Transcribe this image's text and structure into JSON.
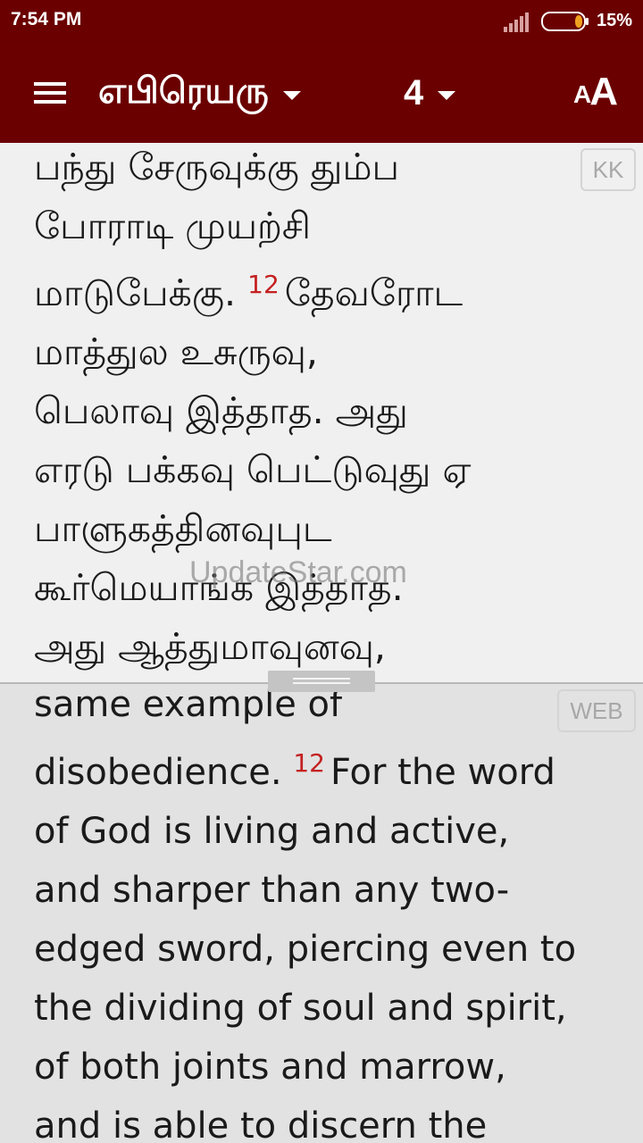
{
  "status_bar": {
    "time": "7:54 PM",
    "battery_percent": "15%",
    "battery_level": 0.15,
    "icons": [
      "signal-icon",
      "battery-icon"
    ]
  },
  "app_bar": {
    "book": "எபிரெயரு",
    "chapter": "4",
    "font_button_small": "A",
    "font_button_large": "A",
    "icons": [
      "menu-icon",
      "caret-down-icon",
      "font-size-icon"
    ],
    "background_color": "#6b0000"
  },
  "top_pane": {
    "version": "KK",
    "lines": [
      "பந்து சேருவுக்கு தும்ப",
      "போராடி முயற்சி",
      "மாடுபேக்கு."
    ],
    "verse12_num": "12",
    "verse12_lines": [
      "தேவரோட",
      "மாத்துல உசுருவு,",
      "பெலாவு இத்தாத. அது",
      "எரடு பக்கவு பெட்டுவுது ஏ",
      "பாளுகத்தினவுபுட",
      "கூர்மெயாங்க இத்தாத.",
      "அது ஆத்துமாவுனவு,"
    ]
  },
  "bottom_pane": {
    "version": "WEB",
    "line1": "same example of",
    "line2": "disobedience.",
    "verse12_num": "12",
    "verse12_first": "For the word",
    "verse12_lines": [
      "of God is living and active,",
      "and sharper than any two-",
      "edged sword, piercing even to",
      "the dividing of soul and spirit,",
      "of both joints and marrow,",
      "and is able to discern the"
    ]
  },
  "watermark": "UpdateStar.com",
  "colors": {
    "verse_number": "#c42020",
    "text": "#1a1a1a"
  }
}
